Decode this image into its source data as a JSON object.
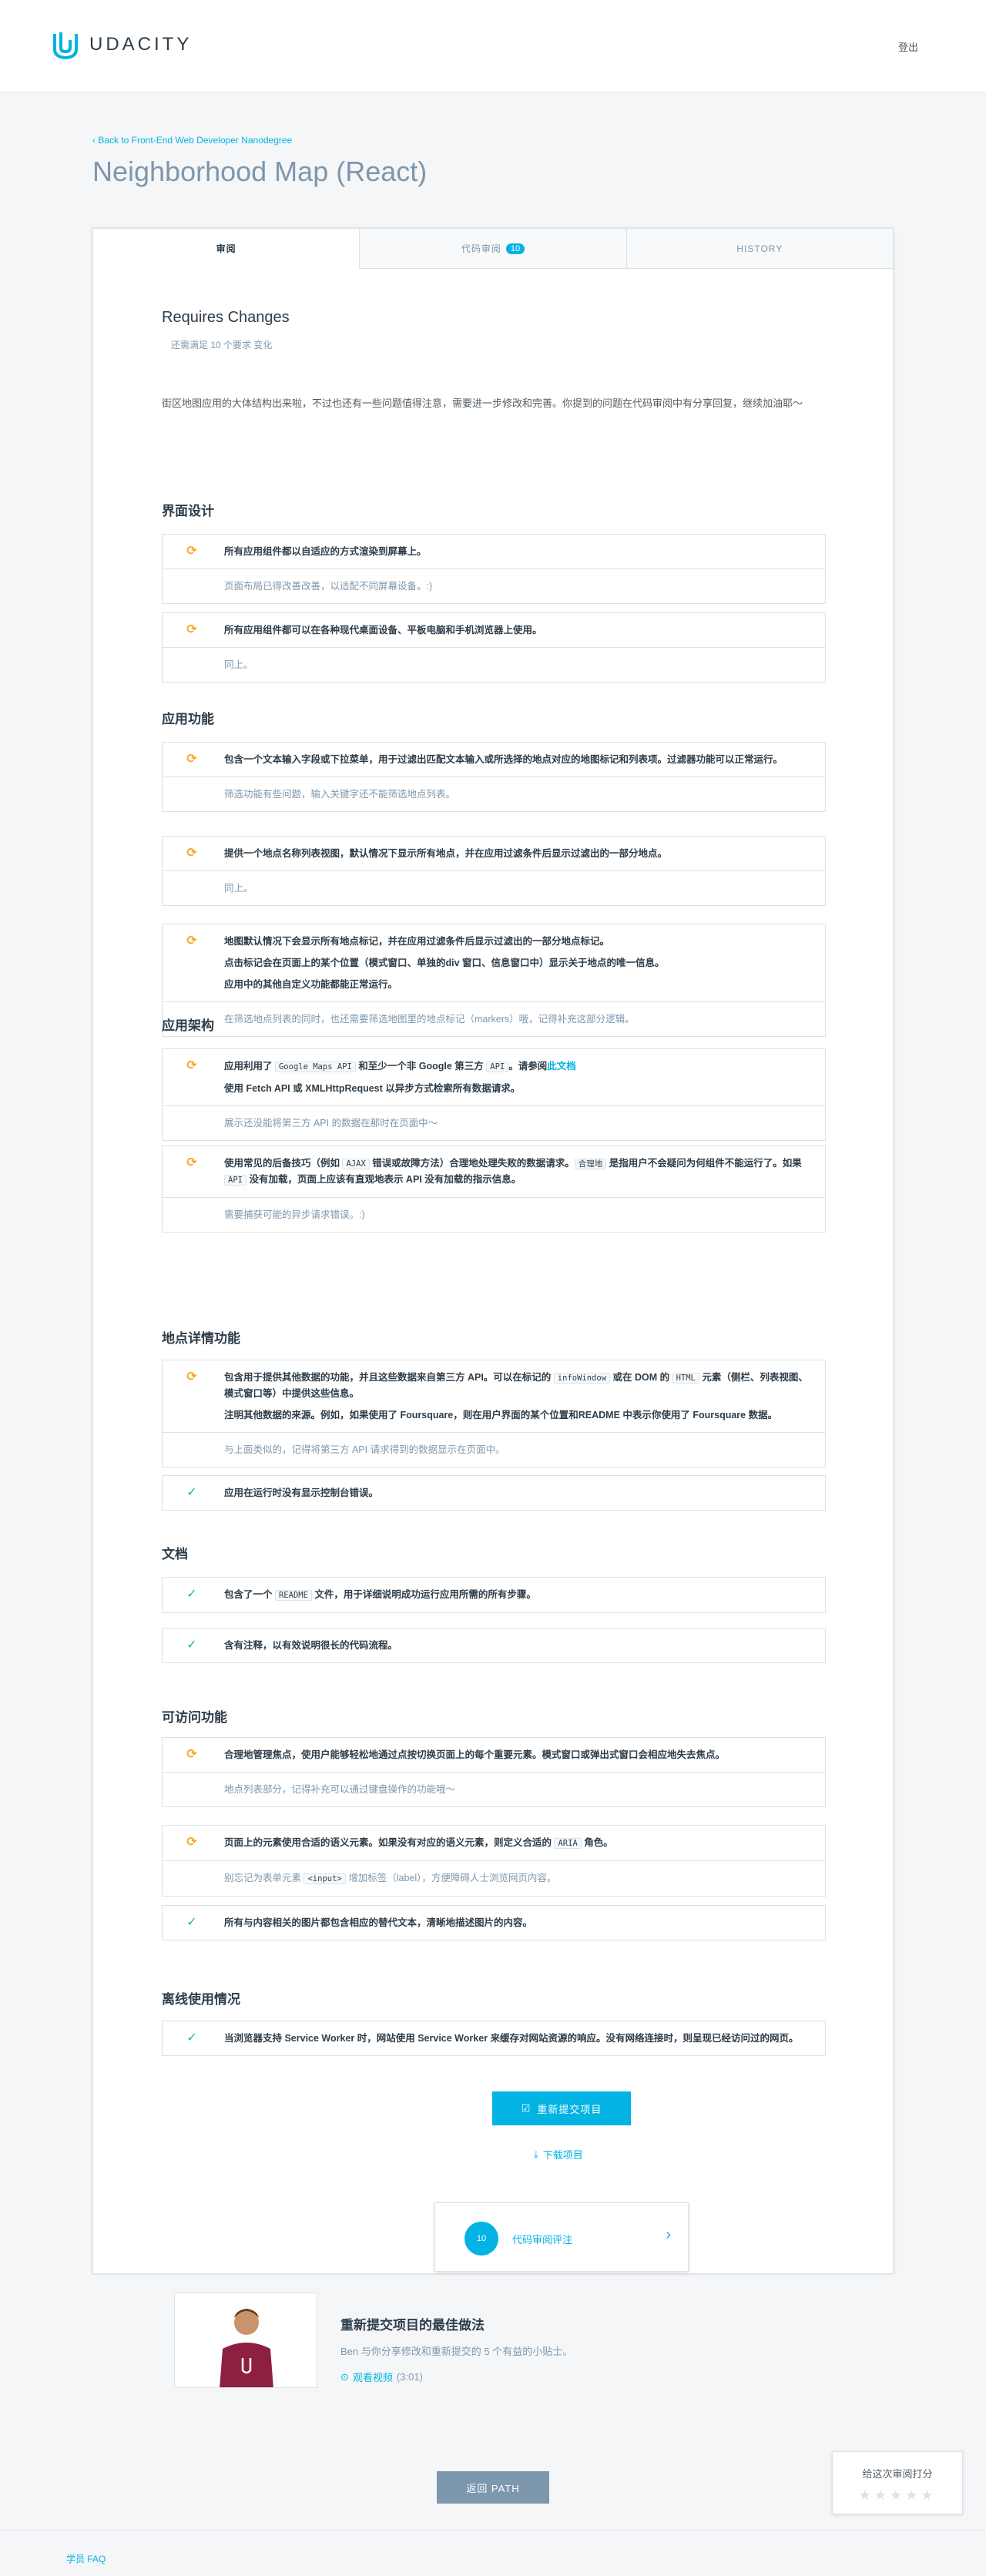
{
  "header": {
    "brand": "UDACITY",
    "logout_label": "登出"
  },
  "nav": {
    "back_link": "‹ Back to Front-End Web Developer Nanodegree"
  },
  "project": {
    "title": "Neighborhood Map (React)"
  },
  "tabs": [
    {
      "label": "审阅",
      "active": true
    },
    {
      "label": "代码审阅",
      "badge": "10"
    },
    {
      "label": "HISTORY"
    }
  ],
  "review": {
    "status_title": "Requires Changes",
    "status_meta": "还需满足 10 个要求 变化",
    "summary": "街区地图应用的大体结构出来啦，不过也还有一些问题值得注意，需要进一步修改和完善。你提到的问题在代码审阅中有分享回复，继续加油耶～"
  },
  "sections": [
    {
      "title": "界面设计",
      "items": [
        {
          "status": "warn",
          "lines": [
            "所有应用组件都以自适应的方式渲染到屏幕上。"
          ],
          "note": "页面布局已得改善改善，以适配不同屏幕设备。:)"
        },
        {
          "status": "warn",
          "lines": [
            "所有应用组件都可以在各种现代桌面设备、平板电脑和手机浏览器上使用。"
          ],
          "note": "同上。"
        }
      ]
    },
    {
      "title": "应用功能",
      "items": [
        {
          "status": "warn",
          "lines": [
            "包含一个文本输入字段或下拉菜单，用于过滤出匹配文本输入或所选择的地点对应的地图标记和列表项。过滤器功能可以正常运行。"
          ],
          "note": "筛选功能有些问题，输入关键字还不能筛选地点列表。"
        },
        {
          "status": "warn",
          "lines": [
            "提供一个地点名称列表视图，默认情况下显示所有地点，并在应用过滤条件后显示过滤出的一部分地点。"
          ],
          "note": "同上。"
        },
        {
          "status": "warn",
          "lines": [
            "地图默认情况下会显示所有地点标记，并在应用过滤条件后显示过滤出的一部分地点标记。",
            "点击标记会在页面上的某个位置（模式窗口、单独的div 窗口、信息窗口中）显示关于地点的唯一信息。",
            "应用中的其他自定义功能都能正常运行。"
          ],
          "note": "在筛选地点列表的同时，也还需要筛选地图里的地点标记（markers）哦，记得补充这部分逻辑。"
        }
      ]
    },
    {
      "title": "应用架构",
      "items": [
        {
          "status": "warn",
          "lines_html": [
            "应用利用了 <span class=\"code\">Google Maps API</span> 和至少一个非 Google 第三方 <span class=\"code\">API</span>。请参阅<span class=\"link\">此文档</span>",
            "使用 Fetch API 或 XMLHttpRequest 以异步方式检索所有数据请求。"
          ],
          "note": "展示还没能将第三方 API 的数据在那时在页面中～"
        },
        {
          "status": "warn",
          "lines_html": [
            "使用常见的后备技巧（例如 <span class=\"code\">AJAX</span> 错误或故障方法）合理地处理失败的数据请求。<span class=\"code\">合理地</span> 是指用户不会疑问为何组件不能运行了。如果 <span class=\"code\">API</span> 没有加载，页面上应该有直观地表示 API 没有加载的指示信息。"
          ],
          "note": "需要捕获可能的异步请求错误。:)"
        }
      ]
    },
    {
      "title": "地点详情功能",
      "items": [
        {
          "status": "warn",
          "lines_html": [
            "包含用于提供其他数据的功能，并且这些数据来自第三方 API。可以在标记的 <span class=\"code\">infoWindow</span> 或在 DOM 的 <span class=\"code\">HTML</span> 元素（侧栏、列表视图、模式窗口等）中提供这些信息。",
            "注明其他数据的来源。例如，如果使用了 Foursquare，则在用户界面的某个位置和README 中表示你使用了 Foursquare 数据。"
          ],
          "note": "与上面类似的，记得将第三方 API 请求得到的数据显示在页面中。"
        },
        {
          "status": "pass",
          "lines": [
            "应用在运行时没有显示控制台错误。"
          ]
        }
      ]
    },
    {
      "title": "文档",
      "items": [
        {
          "status": "pass",
          "lines_html": [
            "包含了一个 <span class=\"code\">README</span> 文件，用于详细说明成功运行应用所需的所有步骤。"
          ]
        },
        {
          "status": "pass",
          "lines": [
            "含有注释，以有效说明很长的代码流程。"
          ]
        }
      ]
    },
    {
      "title": "可访问功能",
      "items": [
        {
          "status": "warn",
          "lines": [
            "合理地管理焦点，使用户能够轻松地通过点按切换页面上的每个重要元素。模式窗口或弹出式窗口会相应地失去焦点。"
          ],
          "note": "地点列表部分，记得补充可以通过键盘操作的功能哦～"
        },
        {
          "status": "warn",
          "lines_html": [
            "页面上的元素使用合适的语义元素。如果没有对应的语义元素，则定义合适的 <span class=\"code\">ARIA</span> 角色。"
          ],
          "note_html": "别忘记为表单元素 <span class=\"code\">&lt;input&gt;</span> 增加标签（label），方便障碍人士浏览网页内容。"
        },
        {
          "status": "pass",
          "lines": [
            "所有与内容相关的图片都包含相应的替代文本，清晰地描述图片的内容。"
          ]
        }
      ]
    },
    {
      "title": "离线使用情况",
      "items": [
        {
          "status": "pass",
          "lines": [
            "当浏览器支持 Service Worker 时，网站使用 Service Worker 来缓存对网站资源的响应。没有网络连接时，则呈现已经访问过的网页。"
          ]
        }
      ]
    }
  ],
  "actions": {
    "resubmit_label": "重新提交项目",
    "download_label": "下载项目",
    "comments_count": "10",
    "comments_label": "代码审阅评注",
    "return_label": "返回 PATH"
  },
  "best_practices": {
    "title": "重新提交项目的最佳做法",
    "subtitle": "Ben 与你分享修改和重新提交的 5 个有益的小贴士。",
    "watch_label": "观看视频",
    "duration": "(3:01)"
  },
  "rating": {
    "label": "给这次审阅打分",
    "stars": "★★★★★"
  },
  "footer": {
    "faq_label": "学员 FAQ"
  },
  "colors": {
    "accent": "#02b3e4",
    "warn": "#f5a623",
    "pass": "#15c26b"
  }
}
